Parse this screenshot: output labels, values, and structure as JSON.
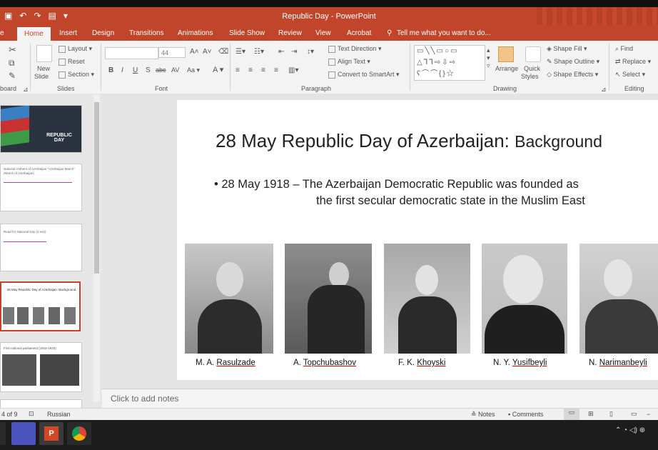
{
  "window": {
    "title": "Republic Day - PowerPoint"
  },
  "tabs": [
    "Home",
    "Insert",
    "Design",
    "Transitions",
    "Animations",
    "Slide Show",
    "Review",
    "View",
    "Acrobat"
  ],
  "tell_me": "Tell me what you want to do...",
  "ribbon": {
    "clipboard_label": "board",
    "new_slide": "New",
    "new_slide2": "Slide",
    "layout": "Layout",
    "reset": "Reset",
    "section": "Section",
    "slides_label": "Slides",
    "font_size": "44",
    "font_label": "Font",
    "text_direction": "Text Direction",
    "align_text": "Align Text",
    "convert_smartart": "Convert to SmartArt",
    "paragraph_label": "Paragraph",
    "arrange": "Arrange",
    "quick_styles": "Quick",
    "quick_styles2": "Styles",
    "shape_fill": "Shape Fill",
    "shape_outline": "Shape Outline",
    "shape_effects": "Shape Effects",
    "drawing_label": "Drawing",
    "find": "Find",
    "replace": "Replace",
    "select": "Select",
    "editing_label": "Editing"
  },
  "thumbnails": [
    {
      "text": "REPUBLIC DAY"
    },
    {
      "text": "National Anthem of Azerbaijan \"Azerbaijan March\" (March of Azerbaijan)"
    },
    {
      "text": "Read for National Day (2 min)"
    },
    {
      "text": "28 May Republic Day of Azerbaijan: Background"
    },
    {
      "text": "First national parliament (1918-1920)"
    }
  ],
  "slide": {
    "title_main": "28 May Republic Day of Azerbaijan: ",
    "title_small": "Background",
    "bullet_line1": "• 28 May 1918 – The Azerbaijan Democratic Republic was founded as",
    "bullet_line2": "the first secular democratic state in the Muslim East",
    "people": [
      {
        "initials": "M. A. ",
        "surname": "Rasulzade"
      },
      {
        "initials": "A. ",
        "surname": "Topchubashov"
      },
      {
        "initials": "F. K. ",
        "surname": "Khoyski"
      },
      {
        "initials": "N. Y. ",
        "surname": "Yusifbeyli"
      },
      {
        "initials": "N. ",
        "surname": "Narimanbeyli"
      }
    ]
  },
  "notes_placeholder": "Click to add notes",
  "status": {
    "slide_pos": "4 of 9",
    "language": "Russian",
    "notes": "Notes",
    "comments": "Comments"
  },
  "colors": {
    "accent": "#c0452b"
  }
}
